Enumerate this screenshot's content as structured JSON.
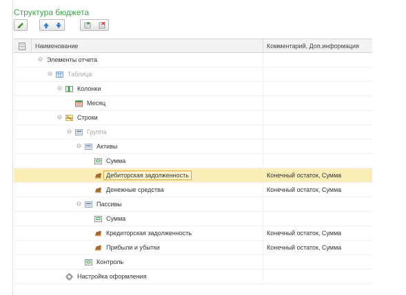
{
  "title": "Структура бюджета",
  "toolbar": {
    "buttons": [
      {
        "name": "edit-button",
        "icon": "pencil-icon"
      },
      {
        "name": "move-up-button",
        "icon": "arrow-up-icon"
      },
      {
        "name": "move-down-button",
        "icon": "arrow-down-icon"
      },
      {
        "name": "add-field-button",
        "icon": "add-table-icon"
      },
      {
        "name": "delete-field-button",
        "icon": "delete-table-icon"
      }
    ]
  },
  "columns": {
    "name_header": "Наименование",
    "comment_header": "Комментарий, Доп.информация"
  },
  "rows": [
    {
      "label": "Элементы отчета",
      "comment": "",
      "level": 0,
      "toggle": "⊖",
      "icon": "none",
      "muted": false,
      "selected": false
    },
    {
      "label": "Таблица",
      "comment": "",
      "level": 1,
      "toggle": "⊖",
      "icon": "table-icon",
      "muted": true,
      "selected": false
    },
    {
      "label": "Колонки",
      "comment": "",
      "level": 2,
      "toggle": "⊖",
      "icon": "columns-icon",
      "muted": false,
      "selected": false
    },
    {
      "label": "Месяц",
      "comment": "",
      "level": 3,
      "toggle": "",
      "icon": "calendar-icon",
      "muted": false,
      "selected": false
    },
    {
      "label": "Строки",
      "comment": "",
      "level": 2,
      "toggle": "⊖",
      "icon": "rows-icon",
      "muted": false,
      "selected": false
    },
    {
      "label": "Группа",
      "comment": "",
      "level": 3,
      "toggle": "⊖",
      "icon": "group-icon",
      "muted": true,
      "selected": false
    },
    {
      "label": "Активы",
      "comment": "",
      "level": 4,
      "toggle": "⊖",
      "icon": "group-icon",
      "muted": false,
      "selected": false
    },
    {
      "label": "Сумма",
      "comment": "",
      "level": 5,
      "toggle": "",
      "icon": "value-icon",
      "muted": false,
      "selected": false
    },
    {
      "label": "Дебиторская задолженность",
      "comment": "Конечный остаток, Сумма",
      "level": 5,
      "toggle": "",
      "icon": "indicator-icon",
      "muted": false,
      "selected": true
    },
    {
      "label": "Денежные средства",
      "comment": "Конечный остаток, Сумма",
      "level": 5,
      "toggle": "",
      "icon": "indicator-icon",
      "muted": false,
      "selected": false
    },
    {
      "label": "Пассивы",
      "comment": "",
      "level": 4,
      "toggle": "⊖",
      "icon": "group-icon",
      "muted": false,
      "selected": false
    },
    {
      "label": "Сумма",
      "comment": "",
      "level": 5,
      "toggle": "",
      "icon": "value-icon",
      "muted": false,
      "selected": false
    },
    {
      "label": "Кредиторская задолженность",
      "comment": "Конечный остаток, Сумма",
      "level": 5,
      "toggle": "",
      "icon": "indicator-icon",
      "muted": false,
      "selected": false
    },
    {
      "label": "Прибыли и убытки",
      "comment": "Конечный остаток, Сумма",
      "level": 5,
      "toggle": "",
      "icon": "indicator-icon",
      "muted": false,
      "selected": false
    },
    {
      "label": "Контроль",
      "comment": "",
      "level": 4,
      "toggle": "",
      "icon": "value-icon",
      "muted": false,
      "selected": false
    },
    {
      "label": "Настройка оформления",
      "comment": "",
      "level": 2,
      "toggle": "",
      "icon": "gear-icon",
      "muted": false,
      "selected": false
    }
  ],
  "colors": {
    "title": "#3aa447",
    "selected_row": "#fbedb7",
    "selected_border": "#e8a33a"
  }
}
